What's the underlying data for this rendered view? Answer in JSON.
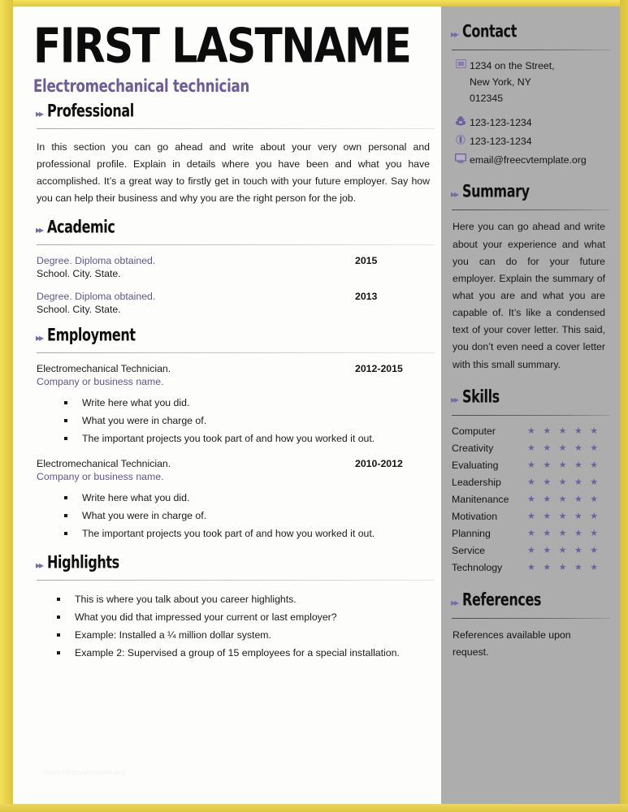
{
  "header": {
    "name": "FIRST LASTNAME",
    "job_title": "Electromechanical technician"
  },
  "arrow_glyph": "▸▸",
  "colors": {
    "accent_purple": "#6d5d96",
    "border_yellow": "#ddc63f",
    "sidebar_gray": "#adadad",
    "star_purple": "#6f5fa0"
  },
  "main": {
    "professional": {
      "heading": "Professional",
      "paragraph": "In this section you can go ahead and write about your very own personal and professional profile. Explain in details where you have been and what you have accomplished. It’s a great way to firstly get in touch with your future employer. Say how you can help their business and why you are the right person for the job."
    },
    "academic": {
      "heading": "Academic",
      "entries": [
        {
          "title": "Degree. Diploma obtained.",
          "date": "2015",
          "subtitle": "School. City. State."
        },
        {
          "title": "Degree. Diploma obtained.",
          "date": "2013",
          "subtitle": "School. City. State."
        }
      ]
    },
    "employment": {
      "heading": "Employment",
      "entries": [
        {
          "title": "Electromechanical Technician.",
          "date": "2012-2015",
          "subtitle": "Company or business name.",
          "bullets": [
            "Write here what you did.",
            "What you were in charge of.",
            "The important projects you took part of and how you worked it out."
          ]
        },
        {
          "title": "Electromechanical Technician.",
          "date": "2010-2012",
          "subtitle": "Company or business name.",
          "bullets": [
            "Write here what you did.",
            "What you were in charge of.",
            "The important projects you took part of and how you worked it out."
          ]
        }
      ]
    },
    "highlights": {
      "heading": "Highlights",
      "bullets": [
        "This is where you talk about you career highlights.",
        "What you did that impressed your current or last employer?",
        "Example: Installed a ¼ million dollar system.",
        "Example 2: Supervised a group of 15 employees for a special installation."
      ]
    },
    "watermark": "www.freecvtemplate.org"
  },
  "sidebar": {
    "contact": {
      "heading": "Contact",
      "rows": [
        {
          "icon": "address-card-icon",
          "lines": [
            "1234 on the Street,",
            "New York, NY",
            "012345"
          ]
        },
        {
          "icon": "telephone-icon",
          "lines": [
            "123-123-1234"
          ]
        },
        {
          "icon": "mobile-phone-icon",
          "lines": [
            "123-123-1234"
          ]
        },
        {
          "icon": "computer-icon",
          "lines": [
            "email@freecvtemplate.org"
          ]
        }
      ]
    },
    "summary": {
      "heading": "Summary",
      "paragraph": "Here you can go ahead and write about your experience and what you can do for your future employer. Explain the summary of what you are and what you are capable of. It’s like a condensed text of your cover letter. This said, you don’t even need a cover letter with this small summary."
    },
    "skills": {
      "heading": "Skills",
      "max_rating": 5,
      "items": [
        {
          "name": "Computer",
          "rating": 5,
          "stars": "★ ★ ★ ★ ★"
        },
        {
          "name": "Creativity",
          "rating": 5,
          "stars": "★ ★ ★ ★ ★"
        },
        {
          "name": "Evaluating",
          "rating": 5,
          "stars": "★ ★ ★ ★ ★"
        },
        {
          "name": "Leadership",
          "rating": 5,
          "stars": "★ ★ ★ ★ ★"
        },
        {
          "name": "Manitenance",
          "rating": 5,
          "stars": "★ ★ ★ ★ ★"
        },
        {
          "name": "Motivation",
          "rating": 5,
          "stars": "★ ★ ★ ★ ★"
        },
        {
          "name": "Planning",
          "rating": 5,
          "stars": "★ ★ ★ ★ ★"
        },
        {
          "name": "Service",
          "rating": 5,
          "stars": "★ ★ ★ ★ ★"
        },
        {
          "name": "Technology",
          "rating": 5,
          "stars": "★ ★ ★ ★ ★"
        }
      ]
    },
    "references": {
      "heading": "References",
      "text": "References available upon request."
    }
  }
}
